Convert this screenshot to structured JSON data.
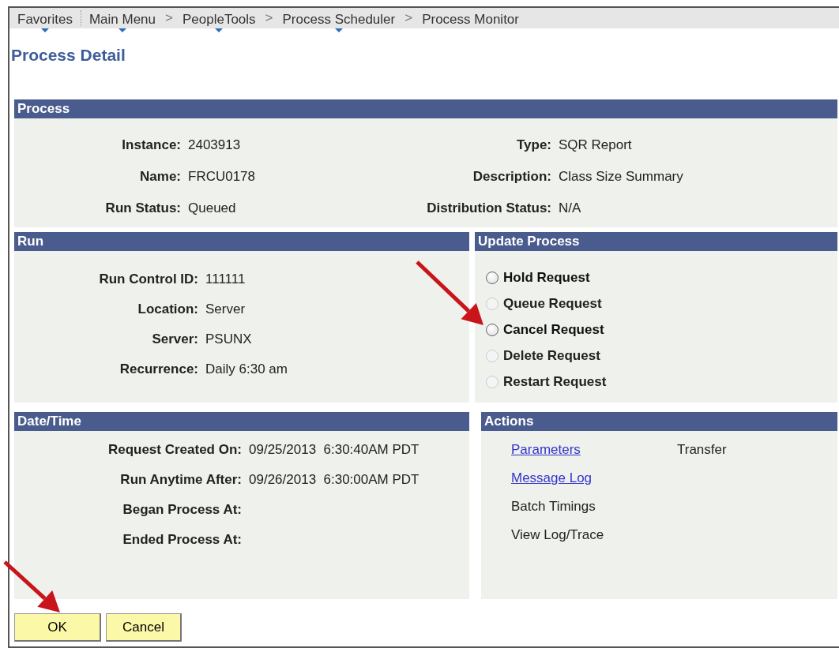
{
  "breadcrumb": [
    {
      "label": "Favorites",
      "menu": true
    },
    {
      "label": "Main Menu",
      "menu": true
    },
    {
      "label": "PeopleTools",
      "menu": true,
      "separator": ">"
    },
    {
      "label": "Process Scheduler",
      "menu": true,
      "separator": ">"
    },
    {
      "label": "Process Monitor",
      "menu": false,
      "separator": ">"
    }
  ],
  "page_title": "Process Detail",
  "process": {
    "title": "Process",
    "fields_left": [
      {
        "label": "Instance:",
        "value": "2403913"
      },
      {
        "label": "Name:",
        "value": "FRCU0178"
      },
      {
        "label": "Run Status:",
        "value": "Queued"
      }
    ],
    "fields_right": [
      {
        "label": "Type:",
        "value": "SQR Report"
      },
      {
        "label": "Description:",
        "value": "Class Size Summary"
      },
      {
        "label": "Distribution Status:",
        "value": "N/A"
      }
    ]
  },
  "run": {
    "title": "Run",
    "fields": [
      {
        "label": "Run Control ID:",
        "value": "111111"
      },
      {
        "label": "Location:",
        "value": "Server"
      },
      {
        "label": "Server:",
        "value": "PSUNX"
      },
      {
        "label": "Recurrence:",
        "value": "Daily 6:30 am"
      }
    ]
  },
  "update_process": {
    "title": "Update Process",
    "options": [
      {
        "label": "Hold Request",
        "disabled": false,
        "selected": false
      },
      {
        "label": "Queue Request",
        "disabled": true,
        "selected": false
      },
      {
        "label": "Cancel Request",
        "disabled": false,
        "selected": false
      },
      {
        "label": "Delete Request",
        "disabled": true,
        "selected": false
      },
      {
        "label": "Restart Request",
        "disabled": true,
        "selected": false
      }
    ]
  },
  "date_time": {
    "title": "Date/Time",
    "fields": [
      {
        "label": "Request Created On:",
        "value": "09/25/2013  6:30:40AM PDT"
      },
      {
        "label": "Run Anytime After:",
        "value": "09/26/2013  6:30:00AM PDT"
      },
      {
        "label": "Began Process At:"
      },
      {
        "label": "Ended Process At:"
      }
    ]
  },
  "actions": {
    "title": "Actions",
    "column_1": [
      {
        "label": "Parameters",
        "link": true
      },
      {
        "label": "Message Log",
        "link": true
      },
      {
        "label": "Batch Timings",
        "link": false
      },
      {
        "label": "View Log/Trace",
        "link": false
      }
    ],
    "column_2": [
      {
        "label": "Transfer",
        "link": false
      }
    ]
  },
  "buttons": [
    {
      "label": "OK"
    },
    {
      "label": "Cancel"
    }
  ]
}
